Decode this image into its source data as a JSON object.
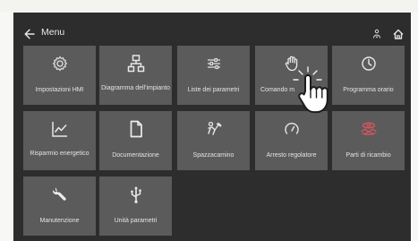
{
  "header": {
    "title": "Menu"
  },
  "tiles": [
    {
      "label": "Impostazioni HMI",
      "icon": "gear-icon"
    },
    {
      "label": "Diagramma dell'impianto",
      "icon": "hierarchy-icon"
    },
    {
      "label": "Liste dei parametri",
      "icon": "sliders-icon"
    },
    {
      "label": "Comando m",
      "icon": "hand-stop-icon"
    },
    {
      "label": "Programma orario",
      "icon": "clock-icon"
    },
    {
      "label": "Risparmio energetico",
      "icon": "trend-chart-icon"
    },
    {
      "label": "Documentazione",
      "icon": "document-icon"
    },
    {
      "label": "Spazzacamino",
      "icon": "chimney-sweep-icon"
    },
    {
      "label": "Arresto regolatore",
      "icon": "gauge-icon"
    },
    {
      "label": "Parti di ricambio",
      "icon": "spare-parts-icon",
      "accent": "#e2545e"
    },
    {
      "label": "Manutenzione",
      "icon": "wrench-icon"
    },
    {
      "label": "Unità parametri",
      "icon": "usb-icon"
    }
  ]
}
